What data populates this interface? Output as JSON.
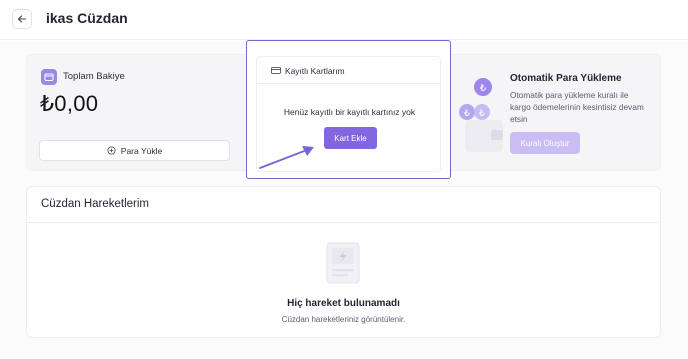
{
  "header": {
    "title": "ikas Cüzdan",
    "back_icon": "arrow-left-icon"
  },
  "balance": {
    "label": "Toplam Bakiye",
    "amount": "₺0,00",
    "load_button": "Para Yükle",
    "icon": "wallet-icon",
    "load_icon": "plus-circle-icon"
  },
  "saved_cards": {
    "title": "Kayıtlı Kartlarım",
    "icon": "credit-card-icon",
    "empty_text": "Henüz kayıtlı bir kayıtlı kartınız yok",
    "add_button": "Kart Ekle"
  },
  "auto_topup": {
    "title": "Otomatik Para Yükleme",
    "description": "Otomatik para yükleme kuralı ile kargo ödemelerinin kesintisiz devam etsin",
    "button": "Kuralı Oluştur",
    "currency_symbol": "₺"
  },
  "transactions": {
    "title": "Cüzdan Hareketlerim",
    "empty_title": "Hiç hareket bulunamadı",
    "empty_subtitle": "Cüzdan hareketleriniz görüntülenir.",
    "icon": "document-empty-icon"
  },
  "colors": {
    "accent": "#8266E0",
    "highlight_border": "#7B63D4",
    "disabled_button": "#C9BDF3"
  }
}
